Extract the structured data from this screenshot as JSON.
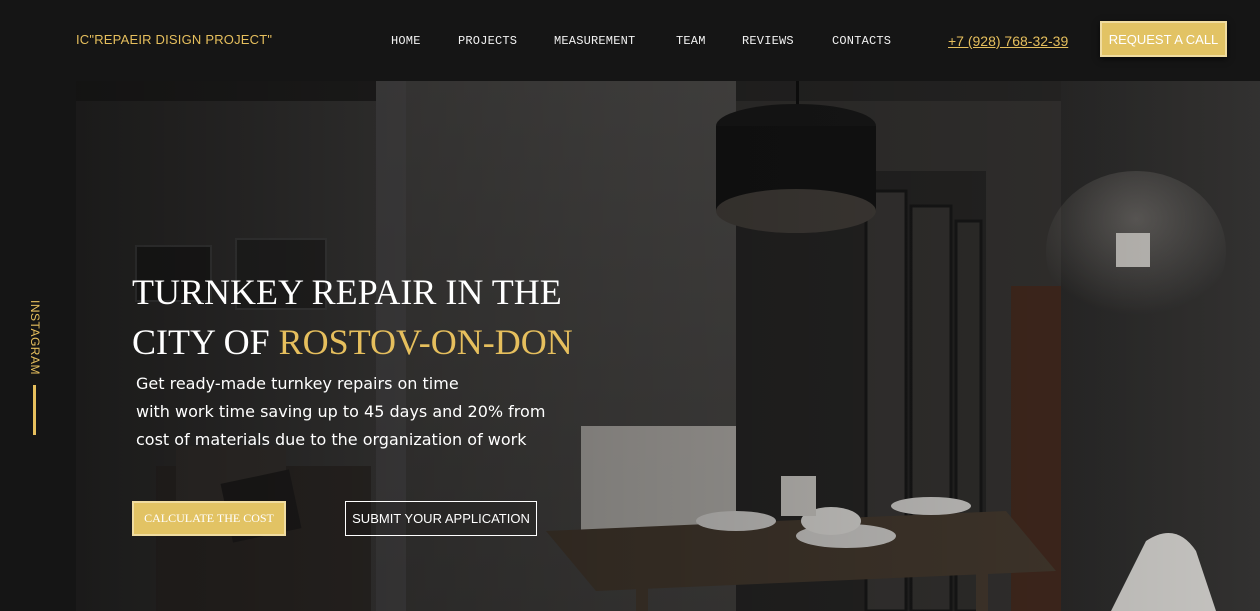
{
  "header": {
    "logo": "IC\"REPAEIR DISIGN PROJECT\"",
    "nav": [
      {
        "label": "HOME"
      },
      {
        "label": "PROJECTS"
      },
      {
        "label": "MEASUREMENT"
      },
      {
        "label": "TEAM"
      },
      {
        "label": "REVIEWS"
      },
      {
        "label": "CONTACTS"
      }
    ],
    "phone": "+7 (928) 768-32-39",
    "request_button": "REQUEST A CALL"
  },
  "sidebar": {
    "instagram": "INSTAGRAM"
  },
  "hero": {
    "title_line1": "TURNKEY REPAIR IN THE",
    "title_line2_prefix": "CITY OF ",
    "title_line2_accent": "ROSTOV-ON-DON",
    "subtitle_lines": [
      "Get ready-made turnkey repairs on time",
      "with work time saving up to 45 days and 20% from",
      "cost of materials due to the organization of work"
    ],
    "calc_button": "CALCULATE THE COST",
    "submit_button": "SUBMIT YOUR APPLICATION"
  },
  "colors": {
    "accent": "#e6bf5d",
    "button_gold": "#e2c364",
    "background": "#151515"
  }
}
